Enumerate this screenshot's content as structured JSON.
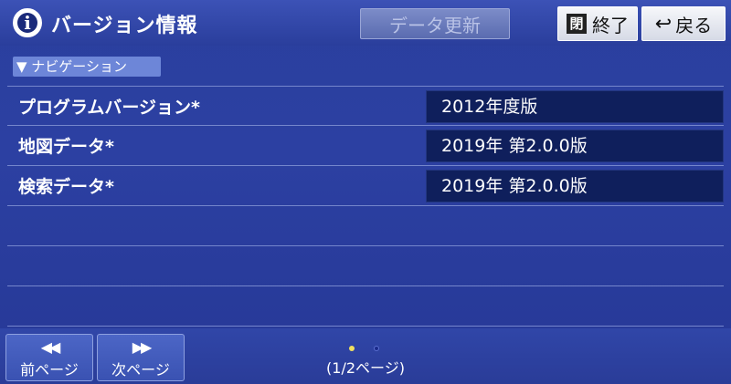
{
  "header": {
    "title": "バージョン情報",
    "info_icon_glyph": "i",
    "update_label": "データ更新",
    "end_label": "終了",
    "end_icon_glyph": "閉",
    "back_label": "戻る",
    "back_icon_glyph": "↩"
  },
  "section": {
    "label": "▼ ナビゲーション"
  },
  "rows": [
    {
      "label": "プログラムバージョン*",
      "value": "2012年度版"
    },
    {
      "label": "地図データ*",
      "value": "2019年 第2.0.0版"
    },
    {
      "label": "検索データ*",
      "value": "2019年 第2.0.0版"
    },
    {
      "label": "",
      "value": ""
    },
    {
      "label": "",
      "value": ""
    },
    {
      "label": "",
      "value": ""
    }
  ],
  "footer": {
    "prev_arrow": "◀◀",
    "prev_label": "前ページ",
    "next_arrow": "▶▶",
    "next_label": "次ページ",
    "page_indicator": "(1/2ページ)"
  },
  "colors": {
    "background": "#2c40a2",
    "value_box": "#0f1f5c",
    "accent_dot": "#f0e060"
  }
}
